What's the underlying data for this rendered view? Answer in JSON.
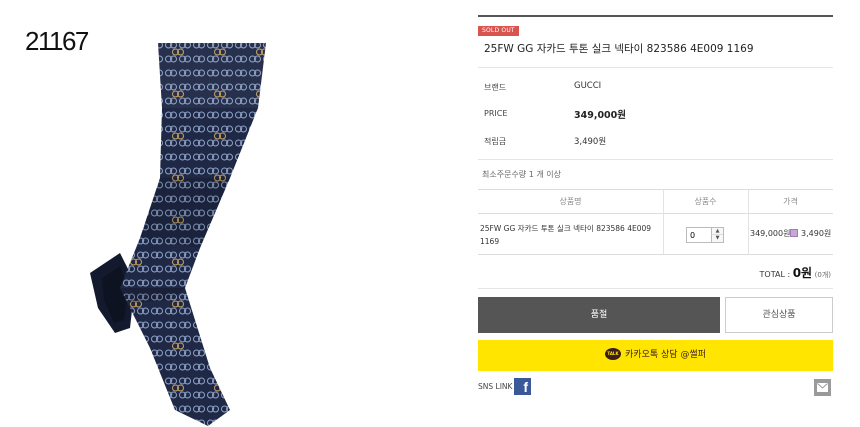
{
  "product": {
    "code": "21167",
    "badge": "SOLD OUT",
    "title": "25FW GG 자카드 투톤 실크 넥타이 823586 4E009 1169"
  },
  "specs": {
    "brand_label": "브랜드",
    "brand_value": "GUCCI",
    "price_label": "PRICE",
    "price_value": "349,000원",
    "points_label": "적립금",
    "points_value": "3,490원"
  },
  "min_order": "최소주문수량 1 개 이상",
  "table": {
    "headers": [
      "상품명",
      "상품수",
      "가격"
    ],
    "row": {
      "name": "25FW GG 자카드 투톤 실크 넥타이 823586 4E009 1169",
      "qty": "0",
      "price": "349,000원",
      "points": "3,490원"
    }
  },
  "total": {
    "label": "TOTAL : ",
    "amount": "0원",
    "count": "(0개)"
  },
  "buttons": {
    "soldout": "품절",
    "wishlist": "관심상품",
    "kakao": "카카오톡 상담 @썰퍼",
    "kakao_badge": "TALK"
  },
  "sns": {
    "label": "SNS LINK",
    "facebook_icon": "facebook-icon",
    "mail_icon": "mail-icon"
  },
  "colors": {
    "sold_badge": "#d9534f",
    "soldout_button": "#555555",
    "kakao": "#ffe500",
    "tie_navy": "#1f2845",
    "pattern_light": "#8fa3c8",
    "pattern_gold": "#c9a35e"
  }
}
